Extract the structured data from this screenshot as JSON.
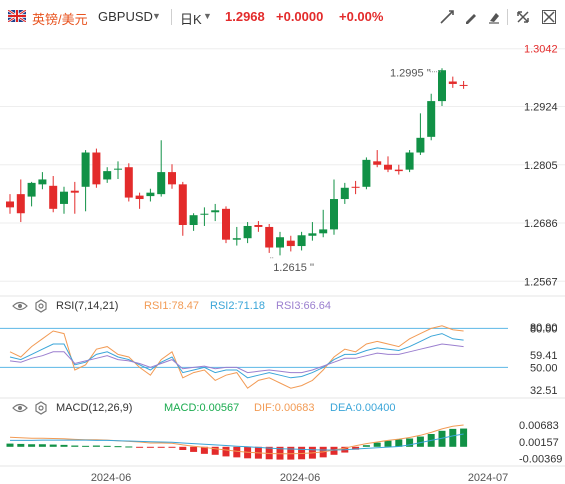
{
  "header": {
    "symbol_name": "英镑/美元",
    "symbol_code": "GBPUSD",
    "period": "日K",
    "price": "1.2968",
    "change": "+0.0000",
    "change_pct": "+0.00%",
    "icons": [
      "flag-uk-icon",
      "dropdown-icon",
      "crosshair-icon",
      "draw-icon",
      "erase-icon",
      "fullscreen-icon",
      "close-icon"
    ]
  },
  "colors": {
    "up": "#e32b2b",
    "down": "#119146",
    "grid": "#eeeeee",
    "accent": "#e8531f"
  },
  "chart_data": [
    {
      "type": "candlestick",
      "name": "GBPUSD 日K",
      "y_ticks": [
        "1.3042",
        "1.2924",
        "1.2805",
        "1.2686",
        "1.2567"
      ],
      "y_tick_values": [
        1.3042,
        1.2924,
        1.2805,
        1.2686,
        1.2567
      ],
      "ylim": [
        1.2537,
        1.3072
      ],
      "x_ticks": [
        "2024-06",
        "2024-06",
        "2024-07"
      ],
      "annotations": [
        {
          "text": "1.2995",
          "value": 1.2995,
          "kind": "high"
        },
        {
          "text": "1.2615",
          "value": 1.2615,
          "kind": "low"
        }
      ],
      "candles": [
        {
          "o": 1.273,
          "h": 1.2745,
          "l": 1.2705,
          "c": 1.2718,
          "dir": "up"
        },
        {
          "o": 1.2745,
          "h": 1.2775,
          "l": 1.2688,
          "c": 1.2706,
          "dir": "up"
        },
        {
          "o": 1.274,
          "h": 1.277,
          "l": 1.272,
          "c": 1.2768,
          "dir": "down"
        },
        {
          "o": 1.2765,
          "h": 1.279,
          "l": 1.2755,
          "c": 1.2775,
          "dir": "down"
        },
        {
          "o": 1.2762,
          "h": 1.2782,
          "l": 1.2708,
          "c": 1.2715,
          "dir": "up"
        },
        {
          "o": 1.2725,
          "h": 1.276,
          "l": 1.2705,
          "c": 1.275,
          "dir": "down"
        },
        {
          "o": 1.2752,
          "h": 1.277,
          "l": 1.2705,
          "c": 1.2748,
          "dir": "up"
        },
        {
          "o": 1.276,
          "h": 1.2835,
          "l": 1.271,
          "c": 1.283,
          "dir": "down"
        },
        {
          "o": 1.283,
          "h": 1.2838,
          "l": 1.2758,
          "c": 1.2765,
          "dir": "up"
        },
        {
          "o": 1.2775,
          "h": 1.28,
          "l": 1.2768,
          "c": 1.2792,
          "dir": "down"
        },
        {
          "o": 1.2795,
          "h": 1.2812,
          "l": 1.2776,
          "c": 1.2797,
          "dir": "down"
        },
        {
          "o": 1.28,
          "h": 1.2808,
          "l": 1.273,
          "c": 1.2738,
          "dir": "up"
        },
        {
          "o": 1.2735,
          "h": 1.2748,
          "l": 1.2715,
          "c": 1.2742,
          "dir": "up"
        },
        {
          "o": 1.2741,
          "h": 1.2756,
          "l": 1.273,
          "c": 1.2748,
          "dir": "down"
        },
        {
          "o": 1.2745,
          "h": 1.2855,
          "l": 1.274,
          "c": 1.279,
          "dir": "down"
        },
        {
          "o": 1.279,
          "h": 1.2806,
          "l": 1.2756,
          "c": 1.2765,
          "dir": "up"
        },
        {
          "o": 1.2765,
          "h": 1.277,
          "l": 1.266,
          "c": 1.2682,
          "dir": "up"
        },
        {
          "o": 1.2682,
          "h": 1.2706,
          "l": 1.267,
          "c": 1.2702,
          "dir": "down"
        },
        {
          "o": 1.2703,
          "h": 1.2718,
          "l": 1.268,
          "c": 1.2705,
          "dir": "down"
        },
        {
          "o": 1.2708,
          "h": 1.2725,
          "l": 1.269,
          "c": 1.2712,
          "dir": "down"
        },
        {
          "o": 1.2715,
          "h": 1.272,
          "l": 1.2645,
          "c": 1.2652,
          "dir": "up"
        },
        {
          "o": 1.2652,
          "h": 1.2678,
          "l": 1.264,
          "c": 1.2655,
          "dir": "down"
        },
        {
          "o": 1.2655,
          "h": 1.2688,
          "l": 1.2645,
          "c": 1.268,
          "dir": "down"
        },
        {
          "o": 1.2682,
          "h": 1.269,
          "l": 1.2668,
          "c": 1.2678,
          "dir": "up"
        },
        {
          "o": 1.2678,
          "h": 1.2684,
          "l": 1.2625,
          "c": 1.2636,
          "dir": "up"
        },
        {
          "o": 1.2636,
          "h": 1.2668,
          "l": 1.262,
          "c": 1.2657,
          "dir": "down"
        },
        {
          "o": 1.265,
          "h": 1.266,
          "l": 1.2628,
          "c": 1.2639,
          "dir": "up"
        },
        {
          "o": 1.2639,
          "h": 1.2668,
          "l": 1.263,
          "c": 1.2661,
          "dir": "down"
        },
        {
          "o": 1.266,
          "h": 1.2688,
          "l": 1.265,
          "c": 1.2665,
          "dir": "down"
        },
        {
          "o": 1.2665,
          "h": 1.2713,
          "l": 1.2657,
          "c": 1.2673,
          "dir": "down"
        },
        {
          "o": 1.2673,
          "h": 1.2775,
          "l": 1.2662,
          "c": 1.2735,
          "dir": "down"
        },
        {
          "o": 1.2735,
          "h": 1.2768,
          "l": 1.2725,
          "c": 1.2758,
          "dir": "down"
        },
        {
          "o": 1.2758,
          "h": 1.2772,
          "l": 1.2745,
          "c": 1.276,
          "dir": "up"
        },
        {
          "o": 1.276,
          "h": 1.282,
          "l": 1.2755,
          "c": 1.2815,
          "dir": "down"
        },
        {
          "o": 1.2812,
          "h": 1.2835,
          "l": 1.28,
          "c": 1.2805,
          "dir": "up"
        },
        {
          "o": 1.2805,
          "h": 1.2822,
          "l": 1.279,
          "c": 1.2795,
          "dir": "up"
        },
        {
          "o": 1.2795,
          "h": 1.2805,
          "l": 1.2785,
          "c": 1.2792,
          "dir": "up"
        },
        {
          "o": 1.2795,
          "h": 1.2835,
          "l": 1.279,
          "c": 1.283,
          "dir": "down"
        },
        {
          "o": 1.283,
          "h": 1.291,
          "l": 1.2825,
          "c": 1.286,
          "dir": "down"
        },
        {
          "o": 1.2862,
          "h": 1.295,
          "l": 1.2855,
          "c": 1.2935,
          "dir": "down"
        },
        {
          "o": 1.2935,
          "h": 1.3002,
          "l": 1.2925,
          "c": 1.2998,
          "dir": "down"
        },
        {
          "o": 1.2975,
          "h": 1.2985,
          "l": 1.2962,
          "c": 1.297,
          "dir": "up"
        },
        {
          "o": 1.2968,
          "h": 1.2976,
          "l": 1.296,
          "c": 1.2968,
          "dir": "up"
        }
      ]
    },
    {
      "type": "line",
      "name": "RSI",
      "title": "RSI(7,14,21)",
      "legend": [
        {
          "text": "RSI1:78.47",
          "color": "#f29b55"
        },
        {
          "text": "RSI2:71.18",
          "color": "#3aa5d8"
        },
        {
          "text": "RSI3:66.64",
          "color": "#9b7fcf"
        }
      ],
      "y_ticks": [
        "80.90",
        "80.00",
        "59.41",
        "50.00",
        "32.51"
      ],
      "y_tick_values": [
        80.9,
        80.0,
        59.41,
        50.0,
        32.51
      ],
      "ylim": [
        28,
        88
      ],
      "series": [
        {
          "name": "RSI1",
          "color": "#f29b55",
          "values": [
            62,
            58,
            66,
            72,
            78,
            76,
            48,
            52,
            64,
            66,
            60,
            58,
            50,
            44,
            56,
            62,
            42,
            46,
            48,
            40,
            44,
            46,
            34,
            40,
            42,
            38,
            34,
            36,
            40,
            48,
            58,
            64,
            62,
            68,
            70,
            68,
            66,
            72,
            76,
            80,
            82,
            79,
            78
          ]
        },
        {
          "name": "RSI2",
          "color": "#3aa5d8",
          "values": [
            58,
            56,
            60,
            64,
            68,
            68,
            52,
            54,
            60,
            62,
            58,
            56,
            52,
            48,
            54,
            58,
            46,
            48,
            50,
            46,
            48,
            48,
            42,
            44,
            46,
            44,
            42,
            43,
            46,
            50,
            56,
            60,
            60,
            63,
            65,
            64,
            63,
            66,
            70,
            74,
            76,
            72,
            71
          ]
        },
        {
          "name": "RSI3",
          "color": "#9b7fcf",
          "values": [
            55,
            54,
            57,
            59,
            62,
            62,
            53,
            55,
            57,
            59,
            56,
            55,
            53,
            50,
            53,
            56,
            49,
            50,
            51,
            49,
            50,
            50,
            46,
            47,
            48,
            47,
            46,
            46,
            48,
            51,
            54,
            57,
            57,
            59,
            61,
            60,
            60,
            62,
            64,
            66,
            68,
            67,
            66
          ]
        }
      ]
    },
    {
      "type": "bar+line",
      "name": "MACD",
      "title": "MACD(12,26,9)",
      "legend": [
        {
          "text": "MACD:0.00567",
          "color": "#1aab4f"
        },
        {
          "text": "DIF:0.00683",
          "color": "#f29b55"
        },
        {
          "text": "DEA:0.00400",
          "color": "#3aa5d8"
        }
      ],
      "y_ticks": [
        "0.00683",
        "0.00157",
        "-0.00369"
      ],
      "y_tick_values": [
        0.00683,
        0.00157,
        -0.00369
      ],
      "ylim": [
        -0.006,
        0.009
      ],
      "histogram": [
        0.001,
        0.0009,
        0.0008,
        0.0008,
        0.0007,
        0.0006,
        0.0004,
        0.0003,
        0.0004,
        0.0003,
        0.0002,
        0.0001,
        -0.0001,
        -0.0003,
        -0.0002,
        -0.0002,
        -0.001,
        -0.0016,
        -0.0022,
        -0.0025,
        -0.003,
        -0.0033,
        -0.0036,
        -0.0037,
        -0.0039,
        -0.004,
        -0.004,
        -0.0039,
        -0.0037,
        -0.0033,
        -0.0025,
        -0.0018,
        -0.0009,
        0.0005,
        0.0013,
        0.0019,
        0.0023,
        0.0026,
        0.0032,
        0.004,
        0.005,
        0.0056,
        0.0057
      ],
      "series": [
        {
          "name": "DIF",
          "color": "#f29b55",
          "values": [
            0.003,
            0.0028,
            0.0027,
            0.0027,
            0.0026,
            0.0025,
            0.0023,
            0.0022,
            0.0022,
            0.0021,
            0.0019,
            0.0017,
            0.0015,
            0.0012,
            0.0012,
            0.0011,
            0.0006,
            0.0002,
            -0.0002,
            -0.0006,
            -0.001,
            -0.0014,
            -0.0017,
            -0.0019,
            -0.0021,
            -0.0022,
            -0.0022,
            -0.0021,
            -0.0019,
            -0.0016,
            -0.001,
            -0.0004,
            0.0003,
            0.001,
            0.0015,
            0.002,
            0.0024,
            0.0029,
            0.0036,
            0.0045,
            0.0056,
            0.0064,
            0.0068
          ]
        },
        {
          "name": "DEA",
          "color": "#3aa5d8",
          "values": [
            0.002,
            0.002,
            0.002,
            0.0021,
            0.0021,
            0.0021,
            0.0021,
            0.0021,
            0.002,
            0.002,
            0.0019,
            0.0018,
            0.0017,
            0.0016,
            0.0015,
            0.0014,
            0.0012,
            0.001,
            0.0008,
            0.0006,
            0.0004,
            0.0002,
            0.0,
            -0.0002,
            -0.0004,
            -0.0006,
            -0.0007,
            -0.0008,
            -0.0009,
            -0.001,
            -0.001,
            -0.0009,
            -0.0007,
            -0.0005,
            -0.0003,
            -0.0001,
            0.0001,
            0.0006,
            0.0013,
            0.002,
            0.0027,
            0.0034,
            0.004
          ]
        }
      ]
    }
  ]
}
